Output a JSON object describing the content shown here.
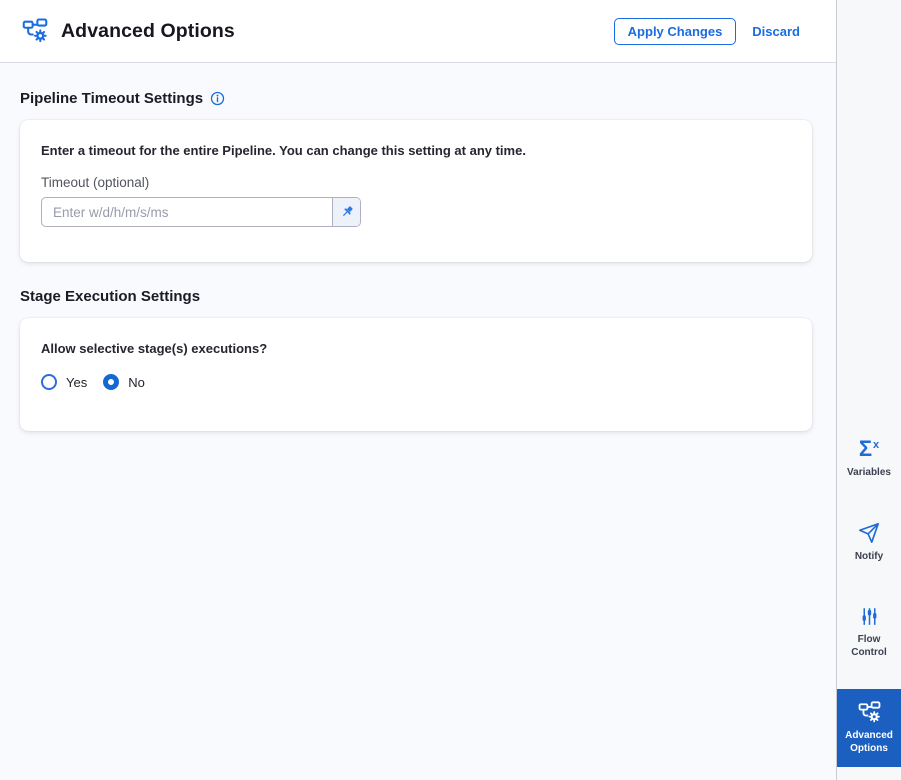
{
  "header": {
    "title": "Advanced Options",
    "apply_label": "Apply Changes",
    "discard_label": "Discard"
  },
  "timeout_section": {
    "heading": "Pipeline Timeout Settings",
    "card": {
      "description": "Enter a timeout for the entire Pipeline. You can change this setting at any time.",
      "field_label": "Timeout (optional)",
      "placeholder": "Enter w/d/h/m/s/ms",
      "value": ""
    }
  },
  "stage_section": {
    "heading": "Stage Execution Settings",
    "card": {
      "question": "Allow selective stage(s) executions?",
      "options": [
        {
          "label": "Yes",
          "selected": false
        },
        {
          "label": "No",
          "selected": true
        }
      ]
    }
  },
  "sidebar": {
    "items": [
      {
        "label": "Variables",
        "icon": "sigma-x-icon",
        "selected": false
      },
      {
        "label": "Notify",
        "icon": "paper-plane-icon",
        "selected": false
      },
      {
        "label": "Flow Control",
        "icon": "sliders-icon",
        "selected": false
      },
      {
        "label": "Advanced Options",
        "icon": "pipeline-gear-icon",
        "selected": true
      }
    ]
  },
  "colors": {
    "accent": "#1a6ce0",
    "nav_selected": "#1b5fc0",
    "page_background": "#f9fafd",
    "sidebar_background": "#f7f8f9"
  }
}
